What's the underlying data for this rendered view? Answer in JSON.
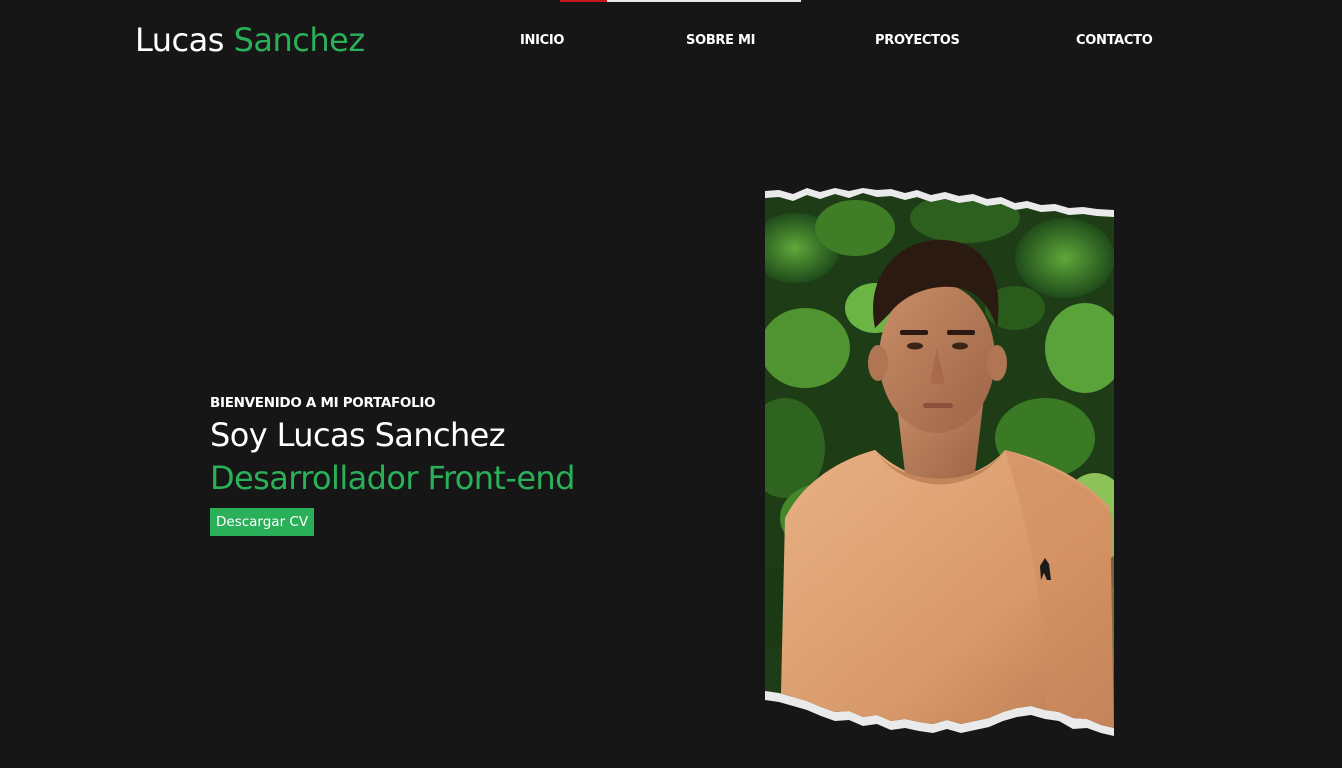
{
  "header": {
    "logo_first": "Lucas",
    "logo_second": "Sanchez",
    "nav": {
      "inicio": "INICIO",
      "sobre": "SOBRE MI",
      "proyectos": "PROYECTOS",
      "contacto": "CONTACTO"
    }
  },
  "hero": {
    "welcome": "BIENVENIDO A MI PORTAFOLIO",
    "name": "Soy Lucas Sanchez",
    "role": "Desarrollador Front-end",
    "cv_button": "Descargar CV"
  },
  "colors": {
    "background": "#161616",
    "accent": "#2bb05a",
    "text": "#ffffff"
  }
}
